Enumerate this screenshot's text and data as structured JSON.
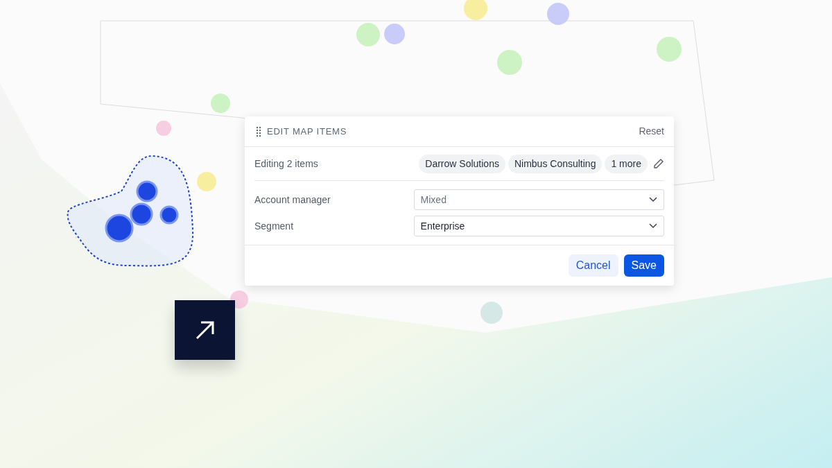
{
  "dialog": {
    "title": "EDIT MAP ITEMS",
    "reset": "Reset",
    "summary": "Editing 2 items",
    "chips": [
      "Darrow Solutions",
      "Nimbus Consulting",
      "1 more"
    ],
    "fields": [
      {
        "label": "Account manager",
        "value": "Mixed",
        "mixed": true
      },
      {
        "label": "Segment",
        "value": "Enterprise",
        "mixed": false
      }
    ],
    "buttons": [
      {
        "label": "Cancel",
        "kind": "secondary"
      },
      {
        "label": "Save",
        "kind": "primary"
      }
    ]
  }
}
